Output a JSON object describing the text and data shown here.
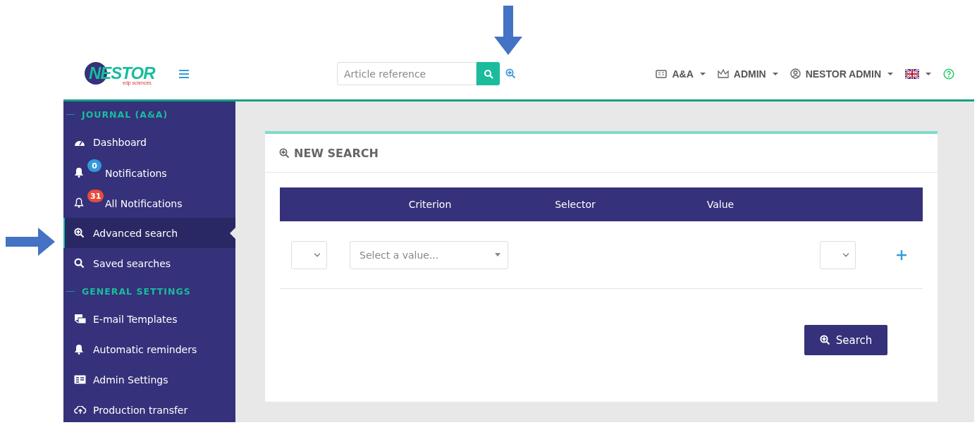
{
  "header": {
    "logo": {
      "name": "NESTOR",
      "sub": "edp sciences"
    },
    "search": {
      "placeholder": "Article reference"
    },
    "menus": [
      {
        "label": "A&A"
      },
      {
        "label": "ADMIN"
      },
      {
        "label": "NESTOR ADMIN"
      }
    ]
  },
  "sidebar": {
    "items": [
      {
        "kind": "heading",
        "label": "JOURNAL (A&A)"
      },
      {
        "kind": "item",
        "label": "Dashboard",
        "selected": false
      },
      {
        "kind": "item",
        "label": "Notifications",
        "selected": false,
        "badge": {
          "text": "0",
          "color": "#3498db"
        }
      },
      {
        "kind": "item",
        "label": "All Notifications",
        "selected": false,
        "badge": {
          "text": "31",
          "color": "#e74c3c"
        }
      },
      {
        "kind": "item",
        "label": "Advanced search",
        "selected": true
      },
      {
        "kind": "item",
        "label": "Saved searches",
        "selected": false
      },
      {
        "kind": "heading",
        "label": "GENERAL SETTINGS"
      },
      {
        "kind": "item",
        "label": "E-mail Templates",
        "selected": false
      },
      {
        "kind": "item",
        "label": "Automatic reminders",
        "selected": false
      },
      {
        "kind": "item",
        "label": "Admin Settings",
        "selected": false
      },
      {
        "kind": "item",
        "label": "Production transfer",
        "selected": false
      }
    ]
  },
  "card": {
    "title": "NEW SEARCH",
    "table": {
      "columns": [
        "Criterion",
        "Selector",
        "Value"
      ]
    },
    "row": {
      "value_placeholder": "Select a value..."
    },
    "button": "Search"
  }
}
